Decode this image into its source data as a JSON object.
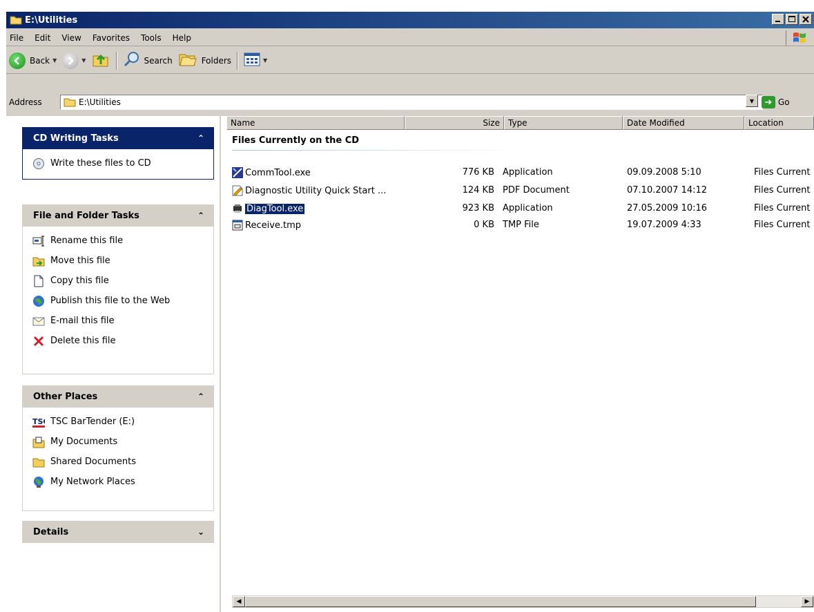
{
  "window": {
    "title": "E:\\Utilities"
  },
  "menu": [
    "File",
    "Edit",
    "View",
    "Favorites",
    "Tools",
    "Help"
  ],
  "toolbar": {
    "back": "Back",
    "search": "Search",
    "folders": "Folders"
  },
  "address": {
    "label": "Address",
    "value": "E:\\Utilities",
    "go": "Go"
  },
  "left": {
    "cd": {
      "title": "CD Writing Tasks",
      "items": [
        "Write these files to CD"
      ]
    },
    "file": {
      "title": "File and Folder Tasks",
      "items": [
        "Rename this file",
        "Move this file",
        "Copy this file",
        "Publish this file to the Web",
        "E-mail this file",
        "Delete this file"
      ]
    },
    "other": {
      "title": "Other Places",
      "items": [
        "TSC BarTender (E:)",
        "My Documents",
        "Shared Documents",
        "My Network Places"
      ]
    },
    "details": {
      "title": "Details"
    }
  },
  "columns": {
    "name": "Name",
    "size": "Size",
    "type": "Type",
    "date": "Date Modified",
    "location": "Location"
  },
  "group": "Files Currently on the CD",
  "files": [
    {
      "name": "CommTool.exe",
      "size": "776 KB",
      "type": "Application",
      "date": "09.09.2008 5:10",
      "location": "Files Current"
    },
    {
      "name": "Diagnostic Utility Quick Start ...",
      "size": "124 KB",
      "type": "PDF Document",
      "date": "07.10.2007 14:12",
      "location": "Files Current"
    },
    {
      "name": "DiagTool.exe",
      "size": "923 KB",
      "type": "Application",
      "date": "27.05.2009 10:16",
      "location": "Files Current"
    },
    {
      "name": "Receive.tmp",
      "size": "0 KB",
      "type": "TMP File",
      "date": "19.07.2009 4:33",
      "location": "Files Current"
    }
  ]
}
